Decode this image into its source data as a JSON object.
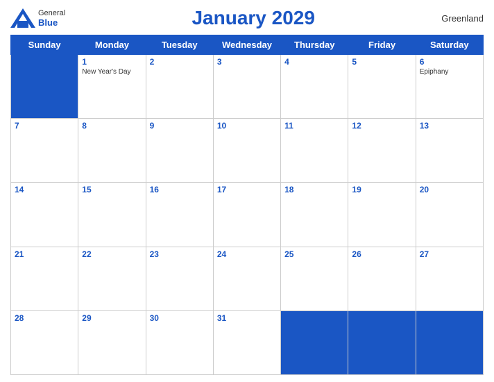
{
  "header": {
    "logo_general": "General",
    "logo_blue": "Blue",
    "title": "January 2029",
    "region": "Greenland"
  },
  "weekdays": [
    "Sunday",
    "Monday",
    "Tuesday",
    "Wednesday",
    "Thursday",
    "Friday",
    "Saturday"
  ],
  "weeks": [
    [
      {
        "day": "",
        "holiday": "",
        "empty": true
      },
      {
        "day": "1",
        "holiday": "New Year's Day",
        "empty": false
      },
      {
        "day": "2",
        "holiday": "",
        "empty": false
      },
      {
        "day": "3",
        "holiday": "",
        "empty": false
      },
      {
        "day": "4",
        "holiday": "",
        "empty": false
      },
      {
        "day": "5",
        "holiday": "",
        "empty": false
      },
      {
        "day": "6",
        "holiday": "Epiphany",
        "empty": false
      }
    ],
    [
      {
        "day": "7",
        "holiday": "",
        "empty": false
      },
      {
        "day": "8",
        "holiday": "",
        "empty": false
      },
      {
        "day": "9",
        "holiday": "",
        "empty": false
      },
      {
        "day": "10",
        "holiday": "",
        "empty": false
      },
      {
        "day": "11",
        "holiday": "",
        "empty": false
      },
      {
        "day": "12",
        "holiday": "",
        "empty": false
      },
      {
        "day": "13",
        "holiday": "",
        "empty": false
      }
    ],
    [
      {
        "day": "14",
        "holiday": "",
        "empty": false
      },
      {
        "day": "15",
        "holiday": "",
        "empty": false
      },
      {
        "day": "16",
        "holiday": "",
        "empty": false
      },
      {
        "day": "17",
        "holiday": "",
        "empty": false
      },
      {
        "day": "18",
        "holiday": "",
        "empty": false
      },
      {
        "day": "19",
        "holiday": "",
        "empty": false
      },
      {
        "day": "20",
        "holiday": "",
        "empty": false
      }
    ],
    [
      {
        "day": "21",
        "holiday": "",
        "empty": false
      },
      {
        "day": "22",
        "holiday": "",
        "empty": false
      },
      {
        "day": "23",
        "holiday": "",
        "empty": false
      },
      {
        "day": "24",
        "holiday": "",
        "empty": false
      },
      {
        "day": "25",
        "holiday": "",
        "empty": false
      },
      {
        "day": "26",
        "holiday": "",
        "empty": false
      },
      {
        "day": "27",
        "holiday": "",
        "empty": false
      }
    ],
    [
      {
        "day": "28",
        "holiday": "",
        "empty": false
      },
      {
        "day": "29",
        "holiday": "",
        "empty": false
      },
      {
        "day": "30",
        "holiday": "",
        "empty": false
      },
      {
        "day": "31",
        "holiday": "",
        "empty": false
      },
      {
        "day": "",
        "holiday": "",
        "empty": true
      },
      {
        "day": "",
        "holiday": "",
        "empty": true
      },
      {
        "day": "",
        "holiday": "",
        "empty": true
      }
    ]
  ],
  "colors": {
    "accent": "#1a56c4",
    "header_bg": "#1a56c4",
    "header_text": "#ffffff",
    "dark_cell": "#1a56c4"
  }
}
